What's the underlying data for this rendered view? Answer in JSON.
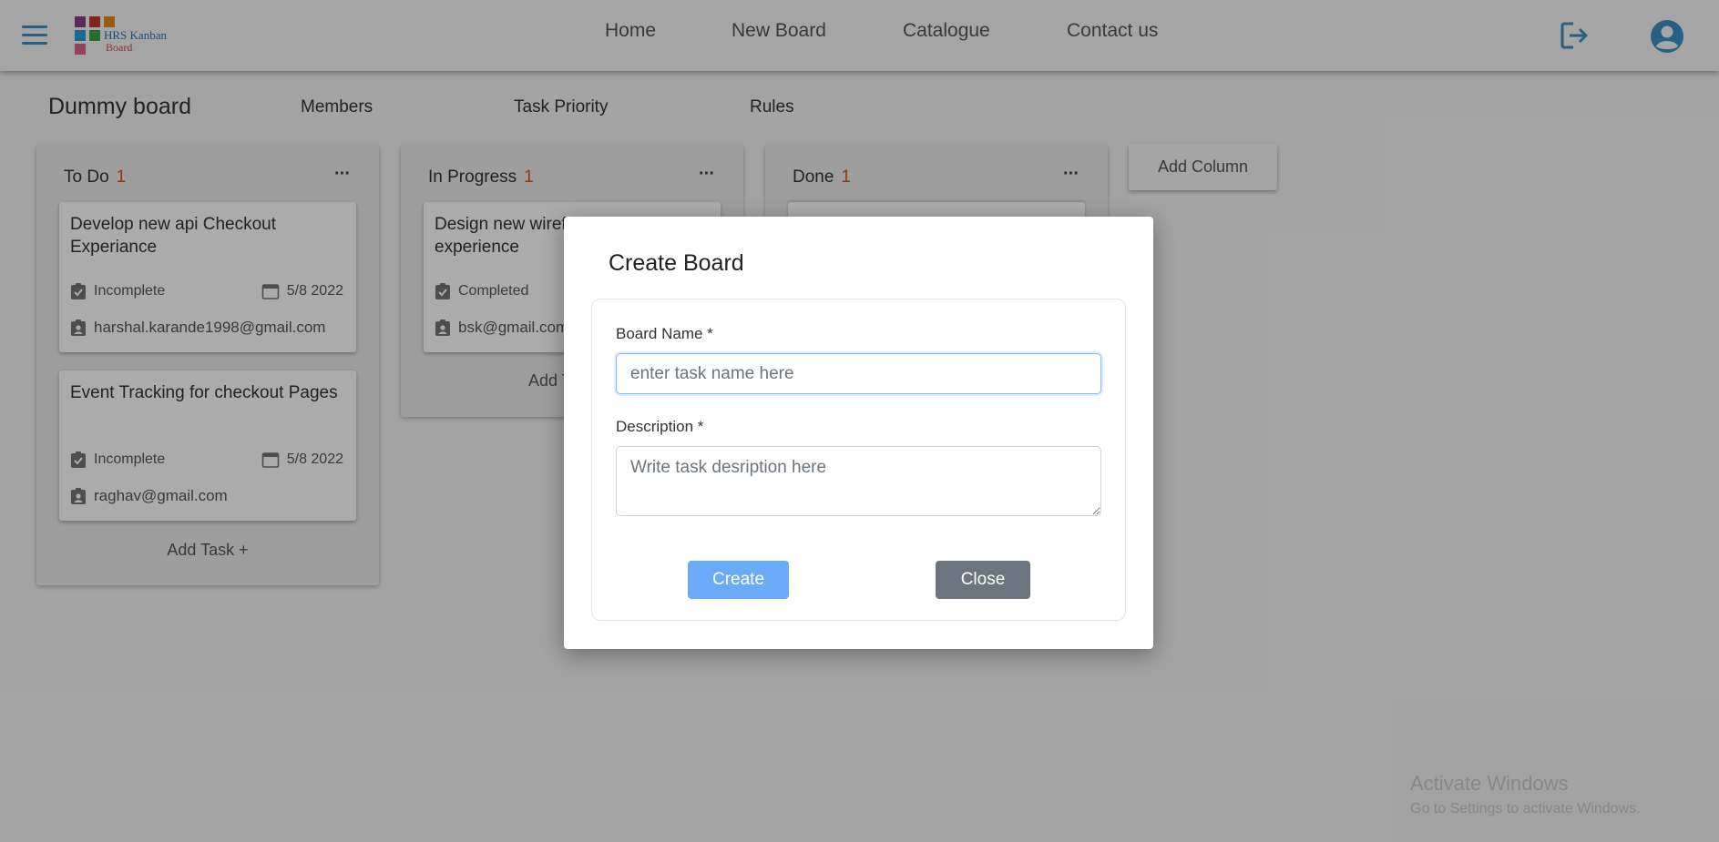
{
  "header": {
    "logo": {
      "line1": "HRS Kanban",
      "line2": "Board"
    },
    "nav": [
      "Home",
      "New Board",
      "Catalogue",
      "Contact us"
    ]
  },
  "board": {
    "title": "Dummy board",
    "tabs": [
      "Members",
      "Task Priority",
      "Rules"
    ],
    "add_column_label": "Add Column",
    "add_task_label": "Add Task +",
    "add_task_partial": "Add T",
    "columns": [
      {
        "title": "To Do",
        "count": "1",
        "menu": "···",
        "cards": [
          {
            "title": "Develop new api Checkout Experiance",
            "status": "Incomplete",
            "date": "5/8 2022",
            "assignee": "harshal.karande1998@gmail.com"
          },
          {
            "title": "Event Tracking for checkout Pages",
            "status": "Incomplete",
            "date": "5/8 2022",
            "assignee": "raghav@gmail.com"
          }
        ]
      },
      {
        "title": "In Progress",
        "count": "1",
        "menu": "···",
        "cards": [
          {
            "title": "Design new wireframe for checkout experience",
            "status": "Completed",
            "assignee": "bsk@gmail.com"
          }
        ]
      },
      {
        "title": "Done",
        "count": "1",
        "menu": "···",
        "cards": []
      }
    ]
  },
  "watermark": {
    "line1": "Activate Windows",
    "line2": "Go to Settings to activate Windows."
  },
  "modal": {
    "title": "Create Board",
    "board_name_label": "Board Name *",
    "board_name_placeholder": "enter task name here",
    "board_name_value": "",
    "description_label": "Description *",
    "description_placeholder": "Write task desription here",
    "description_value": "",
    "create_label": "Create",
    "close_label": "Close"
  },
  "colors": {
    "accent": "#3d8fc4",
    "count": "#d2571b",
    "create_button": "#6aaaf8",
    "close_button": "#6c757d"
  },
  "icons": [
    "menu-icon",
    "logout-icon",
    "account-circle-icon",
    "task-check-icon",
    "calendar-icon",
    "assignee-badge-icon",
    "more-horizontal-icon",
    "resize-handle-icon"
  ]
}
